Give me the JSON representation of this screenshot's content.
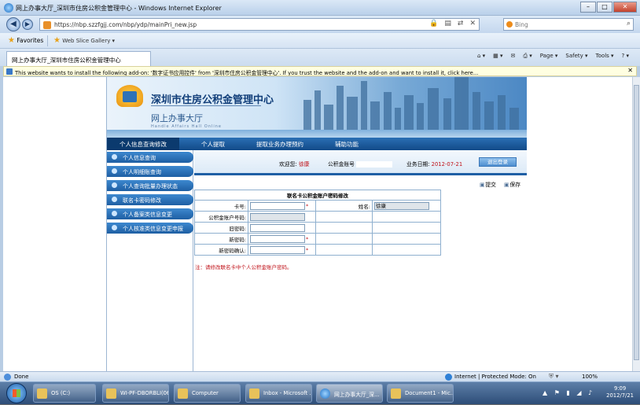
{
  "window": {
    "title": "网上办事大厅_深圳市住房公积金管理中心 - Windows Internet Explorer"
  },
  "address": {
    "url": "https://nbp.szzfgjj.com/nbp/ydp/mainPri_new.jsp"
  },
  "search": {
    "placeholder": "Bing"
  },
  "favorites": {
    "label": "Favorites",
    "item": "Web Slice Gallery ▾"
  },
  "tab": {
    "label": "网上办事大厅_深圳市住房公积金管理中心"
  },
  "commands": [
    "Page ▾",
    "Safety ▾",
    "Tools ▾"
  ],
  "infobar": {
    "text": "This website wants to install the following add-on: '数字证书应用控件' from '深圳市住房公积金管理中心'. If you trust the website and the add-on and want to install it, click here..."
  },
  "banner": {
    "org": "深圳市住房公积金管理中心",
    "hall": "网上办事大厅",
    "hall_en": "Handle Affairs Hall Online"
  },
  "menu": [
    "个人信息查询修改",
    "个人提取",
    "提取业务办理预约",
    "辅助功能"
  ],
  "sidebar": [
    "个人信息查询",
    "个人明细账查询",
    "个人查询批量办理状态",
    "联名卡密码修改",
    "个人备案类信息变更",
    "个人核准类信息变更申报"
  ],
  "user": {
    "welcome": "欢迎您:",
    "name": "徐康",
    "account_label": "公积金账号",
    "date_label": "业务日期:",
    "date": "2012-07-21",
    "logout": "退出登录"
  },
  "toolbar": {
    "submit": "提交",
    "save": "保存"
  },
  "form": {
    "caption": "联名卡公积金账户密码修改",
    "card_label": "卡号:",
    "name_label": "姓名:",
    "name_value": "徐康",
    "acct_pwd_label": "公积金账户号码:",
    "old_pwd_label": "旧密码:",
    "new_pwd_label": "新密码:",
    "confirm_label": "新密码确认:",
    "note": "注：请修改联名卡中个人公积金账户密码。"
  },
  "status": {
    "done": "Done",
    "zone": "Internet | Protected Mode: On",
    "zoom": "100%"
  },
  "taskbar": {
    "items": [
      "OS (C:)",
      "WI-PF-DBORBLI(06)",
      "Computer",
      "Inbox - Microsoft ...",
      "网上办事大厅_深...",
      "Document1 - Mic..."
    ],
    "time": "9:09",
    "date": "2012/7/21"
  }
}
